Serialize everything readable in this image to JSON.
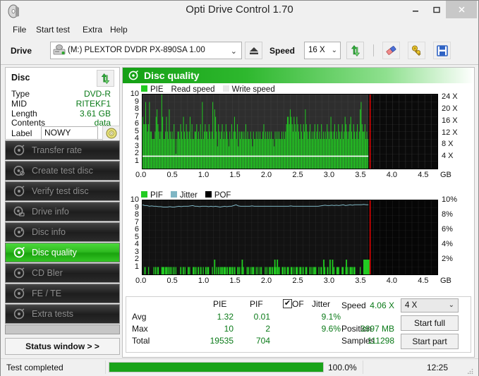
{
  "window": {
    "title": "Opti Drive Control 1.70",
    "icon": "disc-icon",
    "minimize": "–",
    "maximize": "▢",
    "close": "✕"
  },
  "menubar": {
    "items": [
      {
        "label": "File"
      },
      {
        "label": "Start test"
      },
      {
        "label": "Extra"
      },
      {
        "label": "Help"
      }
    ]
  },
  "toolbar": {
    "drive_label": "Drive",
    "drive_value": "(M:)  PLEXTOR DVDR   PX-890SA 1.00",
    "drive_icon": "drive-icon",
    "eject_icon": "eject-icon",
    "speed_label": "Speed",
    "speed_value": "16 X",
    "icons": {
      "refresh": "refresh-arrows-icon",
      "eraser": "eraser-icon",
      "gold": "gold-key-icon",
      "save": "floppy-save-icon"
    }
  },
  "disc_panel": {
    "title": "Disc",
    "refresh_icon": "refresh-arrows-icon",
    "rows": [
      {
        "key": "Type",
        "value": "DVD-R"
      },
      {
        "key": "MID",
        "value": "RITEKF1"
      },
      {
        "key": "Length",
        "value": "3.61 GB"
      },
      {
        "key": "Contents",
        "value": "data"
      }
    ],
    "label_key": "Label",
    "label_value": "NOWY",
    "label_placeholder": "",
    "cd_icon": "compact-disc-icon"
  },
  "sidebar": {
    "items": [
      {
        "label": "Transfer rate",
        "icon": "disc-test-icon",
        "active": false
      },
      {
        "label": "Create test disc",
        "icon": "disc-burn-icon",
        "active": false
      },
      {
        "label": "Verify test disc",
        "icon": "disc-verify-icon",
        "active": false
      },
      {
        "label": "Drive info",
        "icon": "drive-info-icon",
        "active": false
      },
      {
        "label": "Disc info",
        "icon": "disc-info-icon",
        "active": false
      },
      {
        "label": "Disc quality",
        "icon": "disc-quality-icon",
        "active": true
      },
      {
        "label": "CD Bler",
        "icon": "cd-bler-icon",
        "active": false
      },
      {
        "label": "FE / TE",
        "icon": "fe-te-icon",
        "active": false
      },
      {
        "label": "Extra tests",
        "icon": "extra-tests-icon",
        "active": false
      }
    ],
    "status_window_button": "Status window > >"
  },
  "content": {
    "header_title": "Disc quality",
    "header_icon": "disc-quality-icon"
  },
  "stats": {
    "columns": [
      "PIE",
      "PIF",
      "POF",
      "Jitter"
    ],
    "rows": [
      {
        "label": "Avg",
        "pie": "1.32",
        "pif": "0.01",
        "pof": "",
        "jitter": "9.1%"
      },
      {
        "label": "Max",
        "pie": "10",
        "pif": "2",
        "pof": "",
        "jitter": "9.6%"
      },
      {
        "label": "Total",
        "pie": "19535",
        "pif": "704",
        "pof": "",
        "jitter": ""
      }
    ],
    "jitter_checked": true,
    "jitter_check_glyph": "✔",
    "info": [
      {
        "key": "Speed",
        "value": "4.06 X"
      },
      {
        "key": "Position",
        "value": "3697 MB"
      },
      {
        "key": "Samples",
        "value": "111298"
      }
    ],
    "speed_select": "4 X",
    "start_full": "Start full",
    "start_part": "Start part"
  },
  "statusbar": {
    "text": "Test completed",
    "progress_percent": "100.0%",
    "progress_value": 100,
    "time": "12:25",
    "grip_icon": "resize-grip-icon"
  },
  "colors": {
    "pie_green": "#22cc22",
    "jitter_blue": "#7fb6c4",
    "pof_black": "#000000",
    "marker_red": "#ff0000",
    "avg_line_white": "#ffffff",
    "accent_green": "#1aa30e",
    "value_green": "#0a7a18"
  },
  "chart_data": [
    {
      "type": "bar",
      "name": "pie-chart",
      "title": "",
      "legend": [
        {
          "label": "PIE",
          "swatch": "#22cc22"
        },
        {
          "label": "Read speed",
          "swatch": "#ffffff"
        },
        {
          "label": "Write speed",
          "swatch": "#e8e8e8"
        }
      ],
      "legend_position": "top-left",
      "xlabel": "GB",
      "ylabel": "",
      "xlim": [
        0,
        4.7
      ],
      "ylim": [
        0,
        10
      ],
      "xticks": [
        "0.0",
        "0.5",
        "1.0",
        "1.5",
        "2.0",
        "2.5",
        "3.0",
        "3.5",
        "4.0",
        "4.5"
      ],
      "xtick_values": [
        0.0,
        0.5,
        1.0,
        1.5,
        2.0,
        2.5,
        3.0,
        3.5,
        4.0,
        4.5
      ],
      "yticks": [
        "10",
        "9",
        "8",
        "7",
        "6",
        "5",
        "4",
        "3",
        "2",
        "1"
      ],
      "ytick_values": [
        10,
        9,
        8,
        7,
        6,
        5,
        4,
        3,
        2,
        1
      ],
      "y2ticks": [
        "24 X",
        "20 X",
        "16 X",
        "12 X",
        "8 X",
        "4 X"
      ],
      "y2tick_values": [
        24,
        20,
        16,
        12,
        8,
        4
      ],
      "y2lim": [
        0,
        25
      ],
      "grid": true,
      "data_end_x": 3.6,
      "marker_x": 3.62,
      "read_speed_line_y": 1.75,
      "values": [
        7,
        6,
        6,
        9,
        6,
        5,
        6,
        9,
        5,
        5,
        4,
        4,
        4,
        5,
        7,
        8,
        6,
        5,
        4,
        5,
        10,
        7,
        4,
        4,
        5,
        7,
        5,
        4,
        8,
        5,
        4,
        5,
        4,
        6,
        4,
        2,
        4,
        5,
        5,
        4,
        6,
        5,
        4,
        7,
        5,
        4,
        6,
        5,
        4,
        5,
        7,
        4,
        6,
        4,
        4,
        5,
        5,
        6,
        4,
        5,
        4,
        6,
        4,
        9,
        4,
        5,
        6,
        5,
        5,
        4,
        6,
        5,
        4,
        5,
        9,
        4,
        8,
        7,
        5,
        3,
        6,
        5,
        4,
        5,
        6,
        4,
        5,
        4,
        6,
        5,
        4,
        3,
        5,
        4,
        6,
        4,
        5,
        7,
        5,
        4,
        6,
        3,
        5,
        4,
        5,
        5,
        4,
        5,
        4,
        6,
        4,
        5,
        4,
        4,
        5,
        4,
        3,
        5,
        4,
        4,
        5,
        4,
        5,
        4,
        5,
        4,
        4,
        5,
        6,
        4,
        5,
        4,
        5,
        4,
        5,
        4,
        5,
        4,
        4,
        3,
        5,
        4,
        5,
        4,
        5,
        4,
        4,
        5,
        4,
        5,
        4,
        5,
        6,
        7,
        7,
        6,
        8,
        7,
        6,
        5,
        7,
        6,
        5,
        7,
        6,
        5,
        4,
        6,
        5,
        4,
        6,
        5,
        8,
        6,
        5,
        4,
        5,
        6,
        4,
        5,
        4,
        5,
        6,
        4,
        5,
        6,
        4,
        5,
        4,
        6,
        4,
        5,
        4,
        5,
        4,
        6,
        5,
        4,
        5,
        7,
        5,
        4,
        5,
        6,
        4,
        5,
        4,
        6,
        5,
        4,
        5,
        6,
        4,
        5,
        7,
        6,
        5,
        4,
        5,
        6,
        7,
        5,
        4,
        6,
        5,
        4,
        5,
        6,
        4,
        5,
        8,
        9,
        6,
        5,
        5,
        6,
        4,
        5,
        4
      ]
    },
    {
      "type": "bar",
      "name": "pif-jitter-chart",
      "title": "",
      "legend": [
        {
          "label": "PIF",
          "swatch": "#22cc22"
        },
        {
          "label": "Jitter",
          "swatch": "#7fb6c4"
        },
        {
          "label": "POF",
          "swatch": "#000000"
        }
      ],
      "legend_position": "top-left",
      "xlabel": "GB",
      "ylabel": "",
      "xlim": [
        0,
        4.7
      ],
      "ylim": [
        0,
        10
      ],
      "xticks": [
        "0.0",
        "0.5",
        "1.0",
        "1.5",
        "2.0",
        "2.5",
        "3.0",
        "3.5",
        "4.0",
        "4.5"
      ],
      "xtick_values": [
        0.0,
        0.5,
        1.0,
        1.5,
        2.0,
        2.5,
        3.0,
        3.5,
        4.0,
        4.5
      ],
      "yticks": [
        "10",
        "9",
        "8",
        "7",
        "6",
        "5",
        "4",
        "3",
        "2",
        "1"
      ],
      "ytick_values": [
        10,
        9,
        8,
        7,
        6,
        5,
        4,
        3,
        2,
        1
      ],
      "y2ticks": [
        "10%",
        "8%",
        "6%",
        "4%",
        "2%"
      ],
      "y2tick_values": [
        10,
        8,
        6,
        4,
        2
      ],
      "y2lim": [
        0,
        10
      ],
      "grid": true,
      "data_end_x": 3.6,
      "marker_x": 3.62,
      "jitter_series_avg": 9.2,
      "jitter_series": [
        9.4,
        9.3,
        9.3,
        9.2,
        9.25,
        9.2,
        9.2,
        9.15,
        9.15,
        9.1,
        9.1,
        9.1,
        9.15,
        9.1,
        9.1,
        9.15,
        9.2,
        9.15,
        9.2,
        9.2,
        9.2,
        9.25,
        9.3,
        9.2,
        9.2,
        9.15,
        9.2,
        9.2,
        9.2,
        9.15,
        9.2,
        9.15,
        9.2,
        9.15,
        9.1,
        9.15,
        9.2,
        9.15,
        9.2,
        9.2,
        9.3,
        9.4,
        9.25,
        9.2,
        9.2,
        9.2,
        9.2,
        9.2,
        9.25,
        9.2,
        9.2,
        9.2,
        9.2,
        9.2,
        9.2,
        9.2,
        9.2,
        9.2,
        9.2,
        9.2,
        9.2,
        9.2,
        9.2,
        9.2,
        9.2,
        9.25,
        9.2,
        9.2,
        9.2,
        9.2,
        9.2,
        9.2,
        9.2,
        9.2,
        9.2,
        9.2,
        9.2,
        9.2,
        9.25,
        9.3,
        9.35,
        9.3,
        9.3,
        9.35,
        9.3,
        9.35,
        9.3,
        9.35,
        9.4,
        9.3,
        9.35,
        9.4,
        9.35,
        9.4,
        9.4,
        9.4,
        9.4,
        9.45,
        9.4,
        9.4
      ],
      "pif_spikes": [
        {
          "x": 0.03,
          "y": 1
        },
        {
          "x": 0.2,
          "y": 1
        },
        {
          "x": 0.24,
          "y": 1
        },
        {
          "x": 0.3,
          "y": 1
        },
        {
          "x": 0.33,
          "y": 1
        },
        {
          "x": 0.36,
          "y": 1
        },
        {
          "x": 0.4,
          "y": 1
        },
        {
          "x": 0.43,
          "y": 1
        },
        {
          "x": 0.49,
          "y": 1
        },
        {
          "x": 0.6,
          "y": 1
        },
        {
          "x": 0.64,
          "y": 1
        },
        {
          "x": 0.72,
          "y": 1
        },
        {
          "x": 0.8,
          "y": 1
        },
        {
          "x": 0.84,
          "y": 1
        },
        {
          "x": 0.88,
          "y": 1
        },
        {
          "x": 0.92,
          "y": 1
        },
        {
          "x": 1.0,
          "y": 1
        },
        {
          "x": 1.04,
          "y": 1
        },
        {
          "x": 1.14,
          "y": 2
        },
        {
          "x": 1.2,
          "y": 1
        },
        {
          "x": 1.26,
          "y": 1
        },
        {
          "x": 1.3,
          "y": 1
        },
        {
          "x": 1.34,
          "y": 1
        },
        {
          "x": 1.38,
          "y": 1
        },
        {
          "x": 1.42,
          "y": 1
        },
        {
          "x": 1.46,
          "y": 1
        },
        {
          "x": 1.51,
          "y": 1
        },
        {
          "x": 1.58,
          "y": 2
        },
        {
          "x": 1.66,
          "y": 1
        },
        {
          "x": 1.76,
          "y": 1
        },
        {
          "x": 2.03,
          "y": 1
        },
        {
          "x": 2.06,
          "y": 1
        },
        {
          "x": 2.1,
          "y": 2
        },
        {
          "x": 2.14,
          "y": 2
        },
        {
          "x": 2.22,
          "y": 1
        },
        {
          "x": 2.26,
          "y": 1
        },
        {
          "x": 2.3,
          "y": 1
        },
        {
          "x": 2.36,
          "y": 1
        },
        {
          "x": 2.44,
          "y": 1
        },
        {
          "x": 2.5,
          "y": 1
        },
        {
          "x": 2.55,
          "y": 1
        },
        {
          "x": 2.6,
          "y": 1
        },
        {
          "x": 2.66,
          "y": 1
        },
        {
          "x": 2.72,
          "y": 1
        },
        {
          "x": 2.84,
          "y": 1
        },
        {
          "x": 2.88,
          "y": 2
        },
        {
          "x": 2.94,
          "y": 1
        },
        {
          "x": 2.98,
          "y": 2
        },
        {
          "x": 3.02,
          "y": 2
        },
        {
          "x": 3.1,
          "y": 1
        },
        {
          "x": 3.18,
          "y": 1
        },
        {
          "x": 3.24,
          "y": 2
        },
        {
          "x": 3.3,
          "y": 1
        },
        {
          "x": 3.36,
          "y": 1
        },
        {
          "x": 3.52,
          "y": 2
        },
        {
          "x": 3.54,
          "y": 2
        },
        {
          "x": 3.56,
          "y": 1
        }
      ]
    }
  ]
}
